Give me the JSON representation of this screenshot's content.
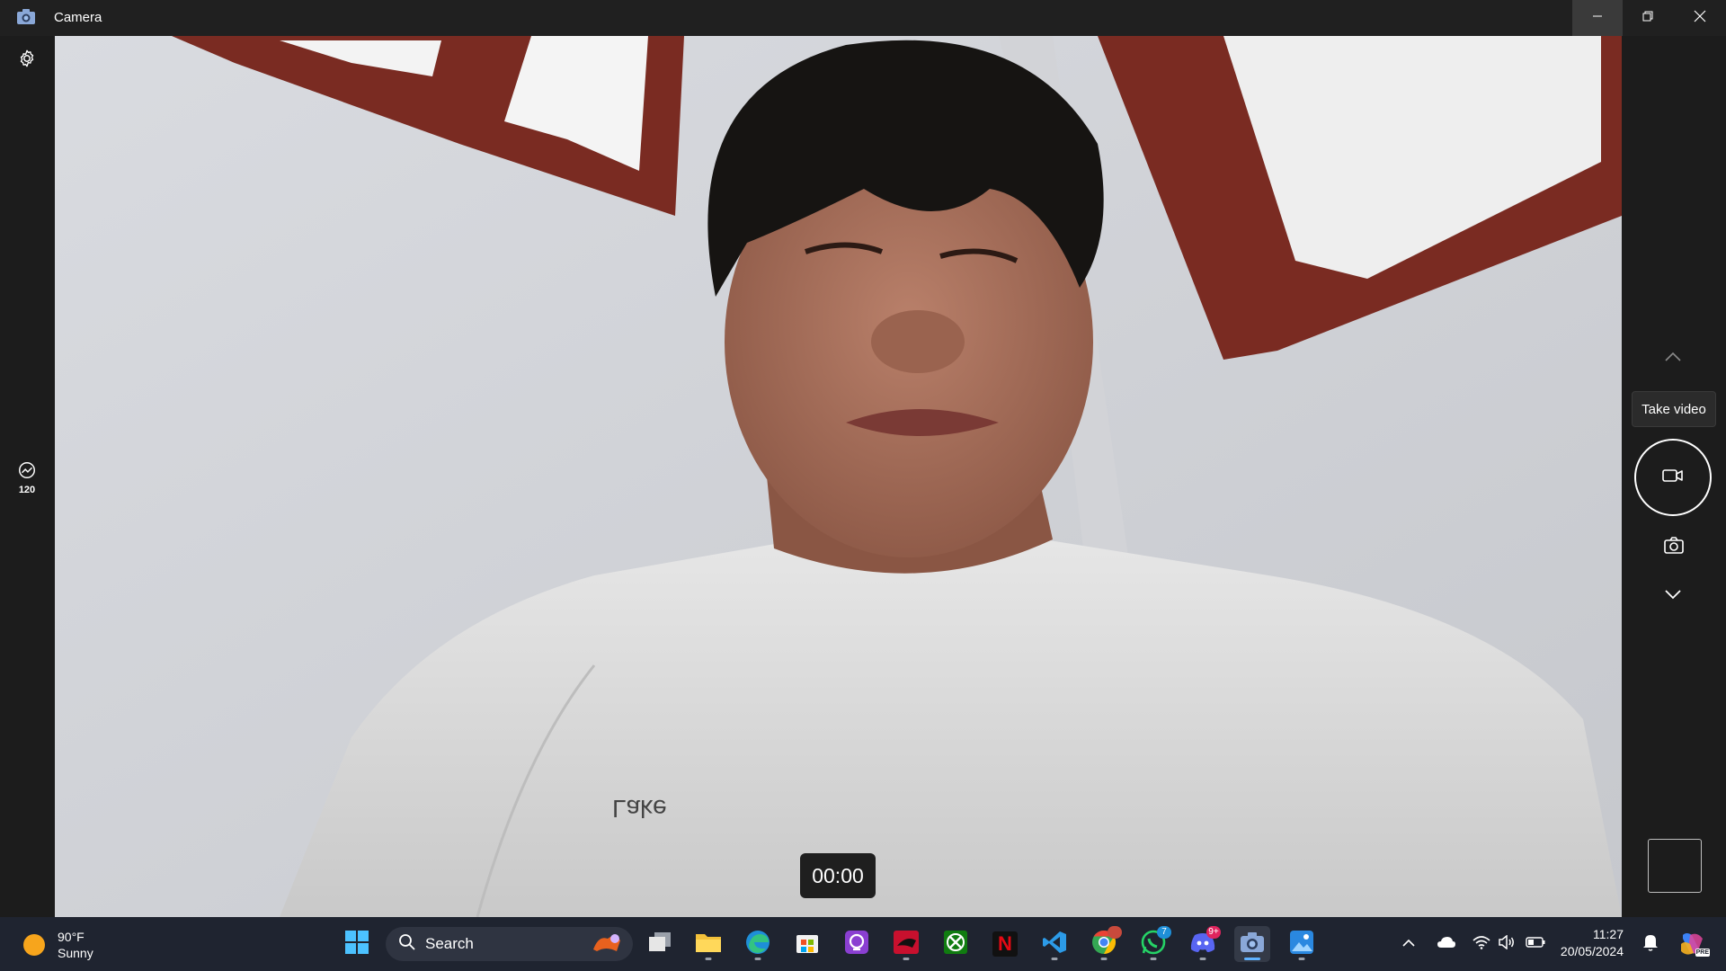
{
  "window": {
    "title": "Camera",
    "minimize_icon": "minimize-icon",
    "maximize_icon": "restore-icon",
    "close_icon": "close-icon"
  },
  "left_rail": {
    "settings_icon": "gear-icon",
    "framerate_icon": "framerate-icon",
    "framerate_label": "120"
  },
  "right_rail": {
    "tooltip": "Take video",
    "shutter_icon": "video-camera-icon",
    "photo_icon": "camera-icon",
    "up_icon": "chevron-up-icon",
    "down_icon": "chevron-down-icon"
  },
  "recording": {
    "timer": "00:00"
  },
  "taskbar": {
    "weather": {
      "temp": "90°F",
      "condition": "Sunny"
    },
    "search_label": "Search",
    "apps": [
      {
        "name": "start",
        "icon": "windows-logo-icon"
      },
      {
        "name": "task-view",
        "icon": "task-view-icon"
      },
      {
        "name": "file-explorer",
        "icon": "folder-icon"
      },
      {
        "name": "edge",
        "icon": "edge-icon"
      },
      {
        "name": "store",
        "icon": "store-icon"
      },
      {
        "name": "app-purple",
        "icon": "purple-app-icon"
      },
      {
        "name": "game-red",
        "icon": "game-icon"
      },
      {
        "name": "xbox",
        "icon": "xbox-icon"
      },
      {
        "name": "netflix",
        "icon": "netflix-icon",
        "label": "N"
      },
      {
        "name": "vscode",
        "icon": "vscode-icon"
      },
      {
        "name": "chrome",
        "icon": "chrome-icon"
      },
      {
        "name": "whatsapp",
        "icon": "whatsapp-icon",
        "badge": "7"
      },
      {
        "name": "discord",
        "icon": "discord-icon",
        "badge": "9+"
      },
      {
        "name": "camera",
        "icon": "camera-app-icon"
      },
      {
        "name": "photos",
        "icon": "photos-icon"
      }
    ],
    "tray": {
      "overflow_icon": "chevron-up-icon",
      "onedrive_icon": "cloud-icon",
      "wifi_icon": "wifi-icon",
      "volume_icon": "volume-icon",
      "battery_icon": "battery-icon",
      "notification_icon": "bell-icon",
      "copilot_icon": "copilot-icon",
      "copilot_badge": "PRE"
    },
    "clock": {
      "time": "11:27",
      "date": "20/05/2024"
    }
  },
  "colors": {
    "accent": "#5fb2ff",
    "taskbar_bg": "#1f2430",
    "app_bg": "#1c1c1c"
  }
}
